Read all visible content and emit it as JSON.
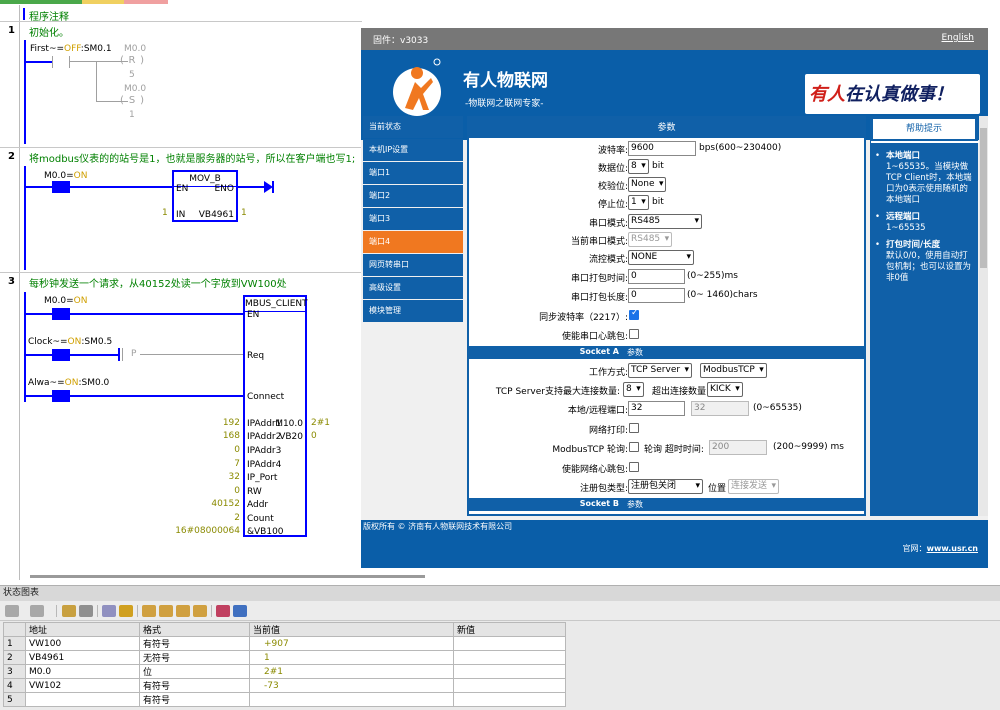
{
  "ladder": {
    "annotation_title": "程序注释",
    "networks": [
      {
        "num": "1",
        "comment": "初始化。"
      },
      {
        "num": "2",
        "comment": "将modbus仪表的的站号是1，也就是服务器的站号，所以在客户端也写1;"
      },
      {
        "num": "3",
        "comment": "每秒钟发送一个请求，从40152处读一个字放到VW100处"
      }
    ],
    "n1": {
      "contact_sym": "First~",
      "contact_eq": "=",
      "contact_state": "OFF",
      "contact_addr": ":SM0.1",
      "coil_r_addr": "M0.0",
      "coil_r": "R",
      "coil_r_n": "5",
      "coil_s_addr": "M0.0",
      "coil_s": "S",
      "coil_s_n": "1"
    },
    "n2": {
      "contact_addr": "M0.0",
      "contact_eq": "=",
      "contact_state": "ON",
      "box_title": "MOV_B",
      "pin_en": "EN",
      "pin_eno": "ENO",
      "pin_in": "IN",
      "in_val": "1",
      "out_label": "VB4961",
      "out_val": "1"
    },
    "n3": {
      "c1_addr": "M0.0",
      "c1_eq": "=",
      "c1_state": "ON",
      "c2_sym": "Clock~",
      "c2_eq": "=",
      "c2_state": "ON",
      "c2_addr": ":SM0.5",
      "p_label": "P",
      "c3_sym": "Alwa~",
      "c3_eq": "=",
      "c3_state": "ON",
      "c3_addr": ":SM0.0",
      "box_title": "MBUS_CLIENT",
      "pin_en": "EN",
      "pin_req": "Req",
      "pin_connect": "Connect",
      "inputs": [
        {
          "val": "192",
          "pin": "IPAddr1"
        },
        {
          "val": "168",
          "pin": "IPAddr2"
        },
        {
          "val": "0",
          "pin": "IPAddr3"
        },
        {
          "val": "7",
          "pin": "IPAddr4"
        },
        {
          "val": "32",
          "pin": "IP_Port"
        },
        {
          "val": "0",
          "pin": "RW"
        },
        {
          "val": "40152",
          "pin": "Addr"
        },
        {
          "val": "2",
          "pin": "Count"
        },
        {
          "val": "16#08000064",
          "pin": "&VB100"
        }
      ],
      "out1_pin": "M10.0",
      "out1_val": "2#1",
      "out2_pin": "VB20",
      "out2_val": "0"
    }
  },
  "status_chart": {
    "title": "状态图表",
    "headers": [
      "地址",
      "格式",
      "当前值",
      "新值"
    ],
    "rows": [
      {
        "num": "1",
        "addr": "VW100",
        "fmt": "有符号",
        "cur": "+907",
        "new": ""
      },
      {
        "num": "2",
        "addr": "VB4961",
        "fmt": "无符号",
        "cur": "1",
        "new": ""
      },
      {
        "num": "3",
        "addr": "M0.0",
        "fmt": "位",
        "cur": "2#1",
        "new": ""
      },
      {
        "num": "4",
        "addr": "VW102",
        "fmt": "有符号",
        "cur": "-73",
        "new": ""
      },
      {
        "num": "5",
        "addr": "",
        "fmt": "有符号",
        "cur": "",
        "new": ""
      }
    ]
  },
  "web": {
    "firmware": "固件：v3033",
    "lang": "English",
    "brand": "有人物联网",
    "brand_sub": "-物联网之联网专家-",
    "slogan_red": "有人",
    "slogan_dark": "在认真做事！",
    "nav": [
      "当前状态",
      "本机IP设置",
      "端口1",
      "端口2",
      "端口3",
      "端口4",
      "网页转串口",
      "高级设置",
      "模块管理"
    ],
    "main_head": "参数",
    "fields": {
      "baud_label": "波特率:",
      "baud_value": "9600",
      "baud_unit": "bps(600~230400)",
      "data_label": "数据位:",
      "data_value": "8",
      "data_unit": "bit",
      "parity_label": "校验位:",
      "parity_value": "None",
      "stop_label": "停止位:",
      "stop_value": "1",
      "stop_unit": "bit",
      "mode_label": "串口模式:",
      "mode_value": "RS485",
      "cur_mode_label": "当前串口模式:",
      "cur_mode_value": "RS485",
      "flow_label": "流控模式:",
      "flow_value": "NONE",
      "pack_time_label": "串口打包时间:",
      "pack_time_value": "0",
      "pack_time_unit": "(0~255)ms",
      "pack_len_label": "串口打包长度:",
      "pack_len_value": "0",
      "pack_len_unit": "(0~ 1460)chars",
      "sync_label": "同步波特率（2217）:",
      "heart_label": "使能串口心跳包:"
    },
    "socket_a": "Socket A",
    "socket_a_param": "参数",
    "sock": {
      "work_label": "工作方式:",
      "work_value": "TCP Server",
      "proto_value": "ModbusTCP",
      "maxconn_label": "TCP Server支持最大连接数量:",
      "maxconn_value": "8",
      "over_label": "超出连接数量",
      "over_value": "KICK",
      "port_label": "本地/远程端口:",
      "local_port": "32",
      "remote_port": "32",
      "port_unit": "(0~65535)",
      "netprint_label": "网络打印:",
      "poll_label": "ModbusTCP 轮询:",
      "poll_sub": "轮询 超时时间:",
      "poll_value": "200",
      "poll_unit": "(200~9999) ms",
      "netheart_label": "使能网络心跳包:",
      "reg_label": "注册包类型:",
      "reg_value": "注册包关闭",
      "pos_label": "位置",
      "pos_value": "连接发送"
    },
    "socket_b": "Socket B",
    "socket_b_param": "参数",
    "help_head": "帮助提示",
    "help": [
      {
        "title": "本地端口",
        "body": "1~65535。当模块做TCP Client时，本地端口为0表示使用随机的本地端口"
      },
      {
        "title": "远程端口",
        "body": "1~65535"
      },
      {
        "title": "打包时间/长度",
        "body": "默认0/0，使用自动打包机制；也可以设置为非0值"
      }
    ],
    "copyright": "版权所有 © 济南有人物联网技术有限公司",
    "site_label": "官网：",
    "site_url": "www.usr.cn"
  },
  "colors": {
    "accent_blue": "#1060a8",
    "active_orange": "#f07820",
    "ladder_blue": "#0000ff",
    "comment_green": "#008000"
  }
}
